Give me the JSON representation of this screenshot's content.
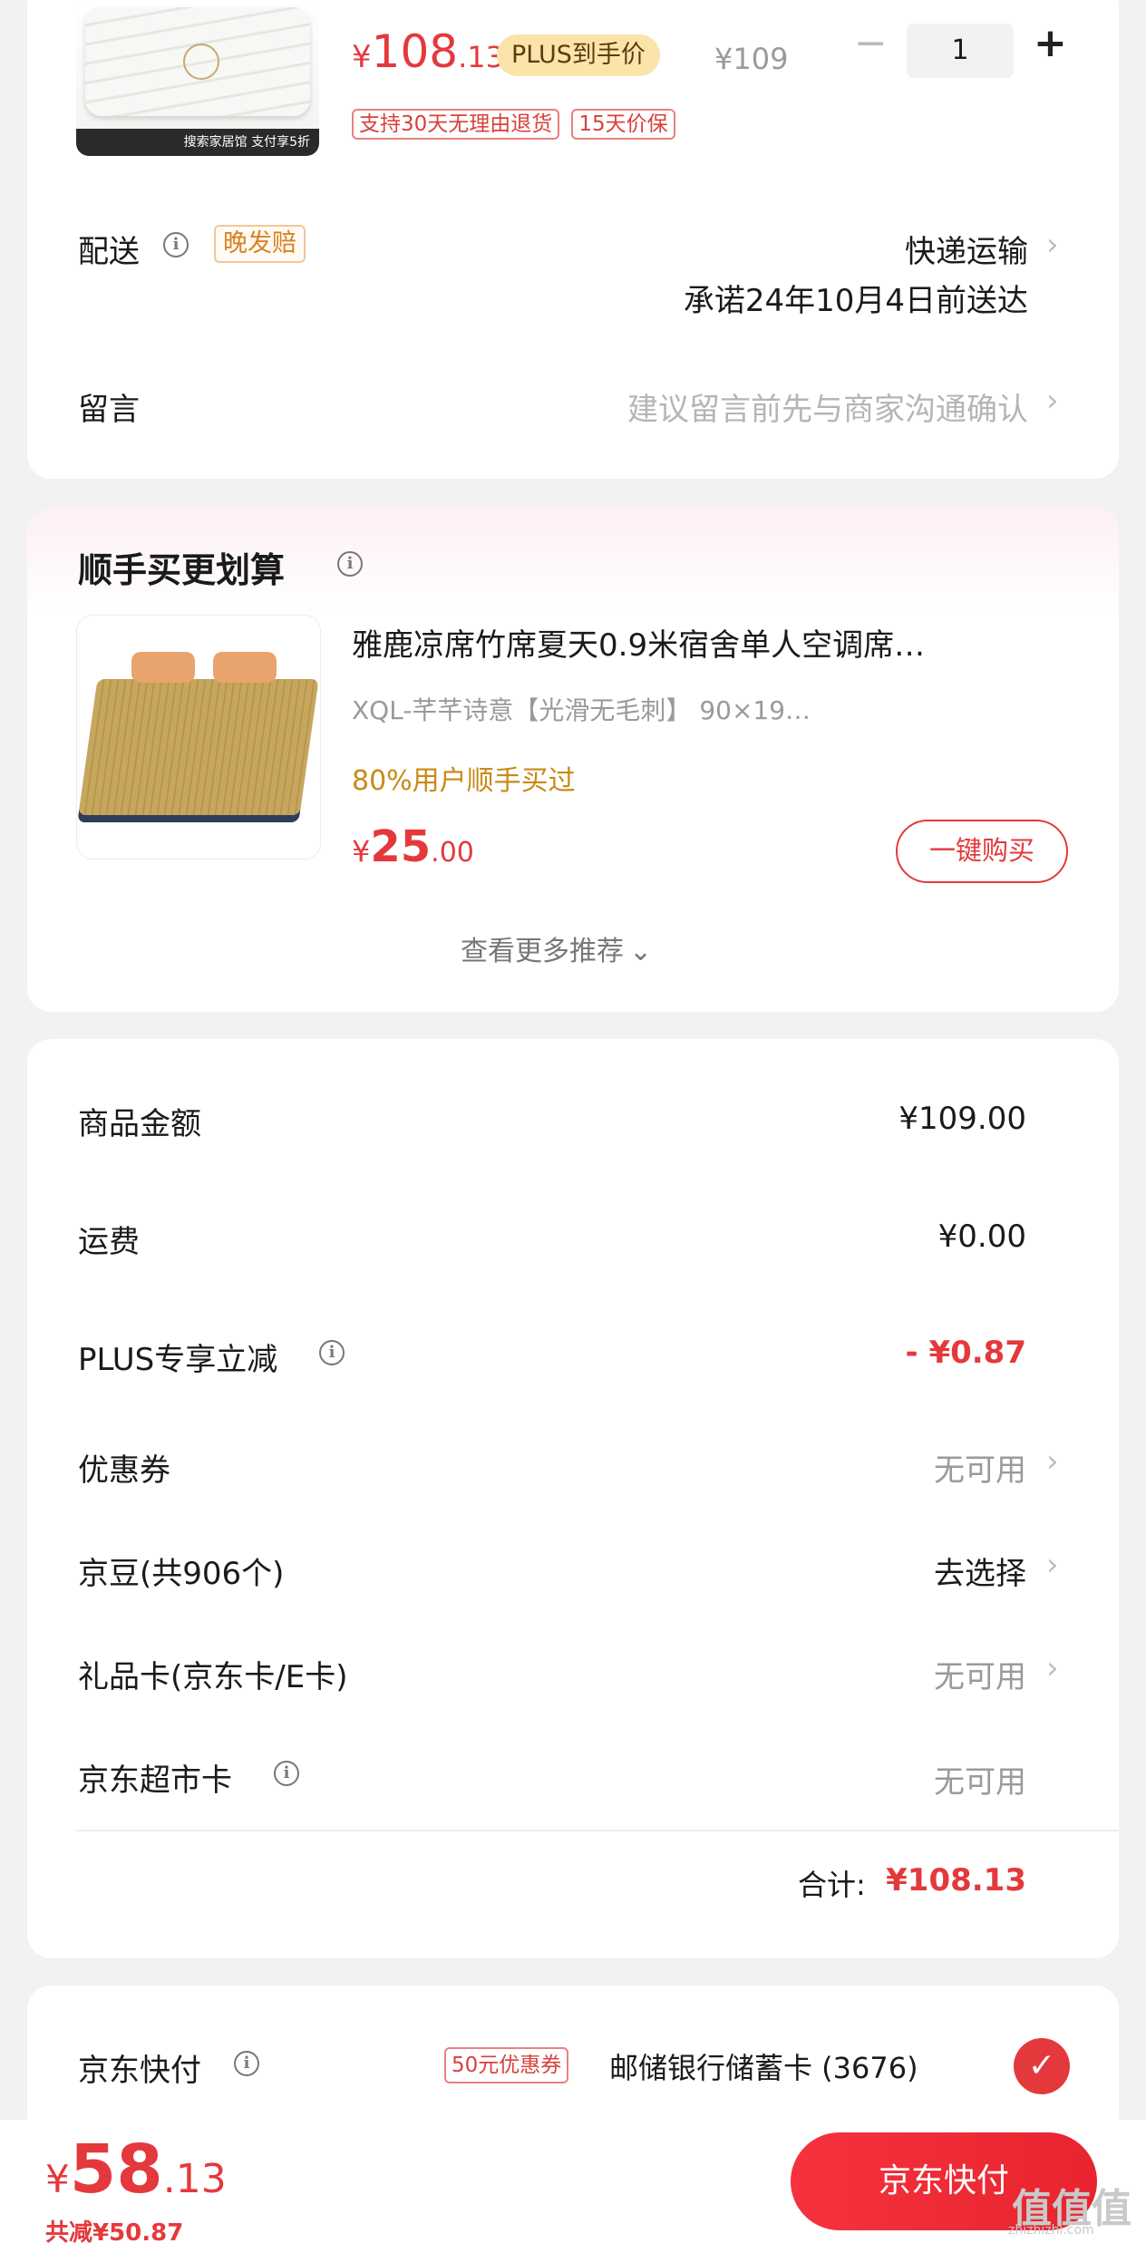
{
  "product": {
    "price_symbol": "¥",
    "price_int": "108",
    "price_dec": ".13",
    "plus_tag": "PLUS到手价",
    "orig_price": "¥109",
    "quantity": "1",
    "minus": "−",
    "plus": "+",
    "tags": [
      "支持30天无理由退货",
      "15天价保"
    ],
    "thumb_banner": "搜索家居馆 支付享5折"
  },
  "delivery": {
    "label": "配送",
    "late_tag": "晚发赔",
    "method": "快递运输",
    "promise": "承诺24年10月4日前送达"
  },
  "message": {
    "label": "留言",
    "placeholder": "建议留言前先与商家沟通确认"
  },
  "recommend": {
    "title": "顺手买更划算",
    "item_title": "雅鹿凉席竹席夏天0.9米宿舍单人空调席…",
    "item_spec": "XQL-芊芊诗意【光滑无毛刺】  90×19…",
    "item_social": "80%用户顺手买过",
    "price_symbol": "¥",
    "price_int": "25",
    "price_dec": ".00",
    "buy_label": "一键购买",
    "more_label": "查看更多推荐"
  },
  "summary": {
    "goods_label": "商品金额",
    "goods_value": "¥109.00",
    "shipping_label": "运费",
    "shipping_value": "¥0.00",
    "plus_label": "PLUS专享立减",
    "plus_value": "- ¥0.87",
    "coupon_label": "优惠券",
    "coupon_value": "无可用",
    "bean_label": "京豆(共906个)",
    "bean_value": "去选择",
    "gift_label": "礼品卡(京东卡/E卡)",
    "gift_value": "无可用",
    "market_label": "京东超市卡",
    "market_value": "无可用",
    "total_label": "合计:",
    "total_value": "¥108.13"
  },
  "payment": {
    "label": "京东快付",
    "coupon_tag": "50元优惠券",
    "card": "邮储银行储蓄卡 (3676)"
  },
  "bottom": {
    "price_symbol": "¥",
    "price_int": "58",
    "price_dec": ".13",
    "saved": "共减¥50.87",
    "pay_button": "京东快付"
  },
  "watermark": {
    "main": "值值值",
    "sub": "zhizhizhi.com"
  },
  "colors": {
    "accent": "#e4393c",
    "plus_gold": "#fbe4a9",
    "late_tag": "#d8821f"
  }
}
